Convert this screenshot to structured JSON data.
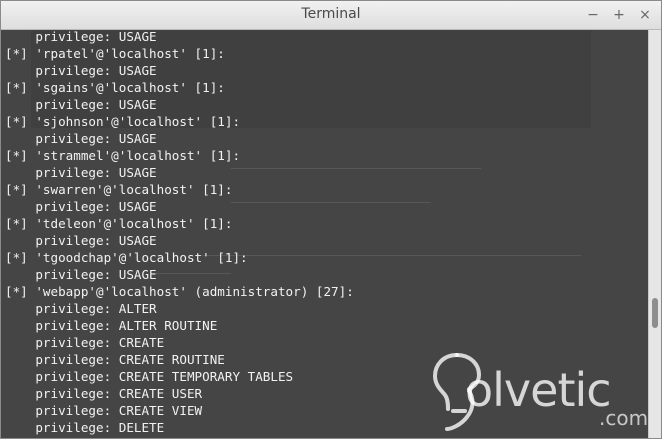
{
  "window": {
    "title": "Terminal",
    "controls": {
      "minimize": "−",
      "maximize": "+",
      "close": "×"
    }
  },
  "terminal": {
    "lines": [
      "    privilege: USAGE",
      "[*] 'rpatel'@'localhost' [1]:",
      "    privilege: USAGE",
      "[*] 'sgains'@'localhost' [1]:",
      "    privilege: USAGE",
      "[*] 'sjohnson'@'localhost' [1]:",
      "    privilege: USAGE",
      "[*] 'strammel'@'localhost' [1]:",
      "    privilege: USAGE",
      "[*] 'swarren'@'localhost' [1]:",
      "    privilege: USAGE",
      "[*] 'tdeleon'@'localhost' [1]:",
      "    privilege: USAGE",
      "[*] 'tgoodchap'@'localhost' [1]:",
      "    privilege: USAGE",
      "[*] 'webapp'@'localhost' (administrator) [27]:",
      "    privilege: ALTER",
      "    privilege: ALTER ROUTINE",
      "    privilege: CREATE",
      "    privilege: CREATE ROUTINE",
      "    privilege: CREATE TEMPORARY TABLES",
      "    privilege: CREATE USER",
      "    privilege: CREATE VIEW",
      "    privilege: DELETE"
    ]
  },
  "watermark": {
    "word": "olvetic",
    "suffix": ".com"
  }
}
